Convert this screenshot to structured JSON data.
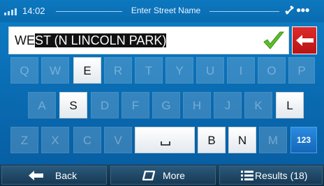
{
  "status_bar": {
    "time": "14:02",
    "title": "Enter Street Name",
    "gps_icon": "satellite-icon",
    "signal_icon": "signal-bars-icon"
  },
  "input": {
    "typed": "WE",
    "autocomplete": "ST (N LINCOLN PARK)",
    "confirm_icon": "checkmark-icon",
    "delete_icon": "backspace-arrow-icon"
  },
  "keyboard": {
    "row1": [
      "Q",
      "W",
      "E",
      "R",
      "T",
      "Y",
      "U",
      "I",
      "O",
      "P"
    ],
    "row2": [
      "A",
      "S",
      "D",
      "F",
      "G",
      "H",
      "J",
      "K",
      "L"
    ],
    "row3": [
      "Z",
      "X",
      "C",
      "V",
      "B",
      "N",
      "M"
    ],
    "space_label": "␣",
    "num_label": "123",
    "enabled_keys": [
      "E",
      "S",
      "L",
      "B",
      "N"
    ]
  },
  "bottom_bar": {
    "back_label": "Back",
    "more_label": "More",
    "results_label": "Results (18)"
  },
  "colors": {
    "accent": "#0a6db4",
    "delete": "#d01e1e",
    "confirm": "#5bbf2a"
  }
}
